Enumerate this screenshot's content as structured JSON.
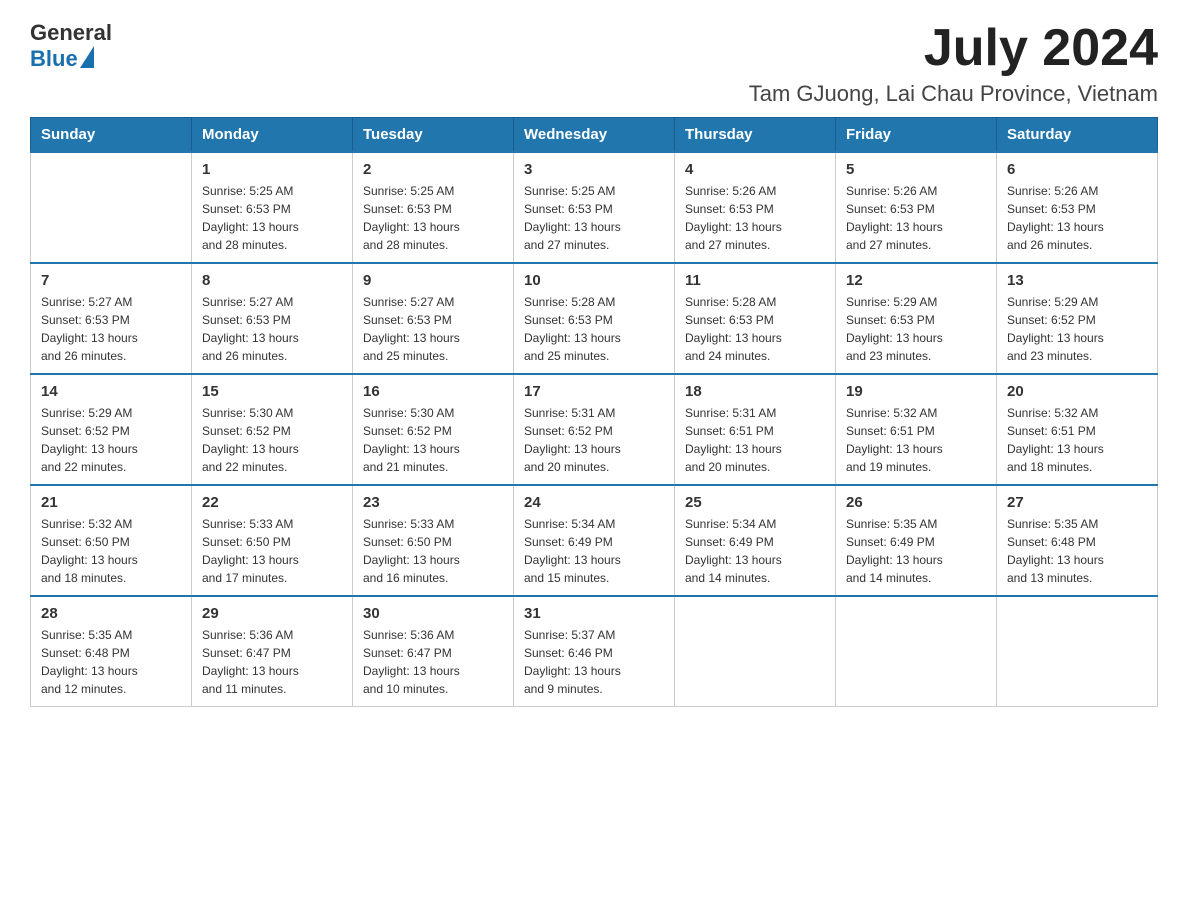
{
  "header": {
    "logo_general": "General",
    "logo_blue": "Blue",
    "month_year": "July 2024",
    "location": "Tam GJuong, Lai Chau Province, Vietnam"
  },
  "weekdays": [
    "Sunday",
    "Monday",
    "Tuesday",
    "Wednesday",
    "Thursday",
    "Friday",
    "Saturday"
  ],
  "weeks": [
    [
      {
        "day": "",
        "info": ""
      },
      {
        "day": "1",
        "info": "Sunrise: 5:25 AM\nSunset: 6:53 PM\nDaylight: 13 hours\nand 28 minutes."
      },
      {
        "day": "2",
        "info": "Sunrise: 5:25 AM\nSunset: 6:53 PM\nDaylight: 13 hours\nand 28 minutes."
      },
      {
        "day": "3",
        "info": "Sunrise: 5:25 AM\nSunset: 6:53 PM\nDaylight: 13 hours\nand 27 minutes."
      },
      {
        "day": "4",
        "info": "Sunrise: 5:26 AM\nSunset: 6:53 PM\nDaylight: 13 hours\nand 27 minutes."
      },
      {
        "day": "5",
        "info": "Sunrise: 5:26 AM\nSunset: 6:53 PM\nDaylight: 13 hours\nand 27 minutes."
      },
      {
        "day": "6",
        "info": "Sunrise: 5:26 AM\nSunset: 6:53 PM\nDaylight: 13 hours\nand 26 minutes."
      }
    ],
    [
      {
        "day": "7",
        "info": "Sunrise: 5:27 AM\nSunset: 6:53 PM\nDaylight: 13 hours\nand 26 minutes."
      },
      {
        "day": "8",
        "info": "Sunrise: 5:27 AM\nSunset: 6:53 PM\nDaylight: 13 hours\nand 26 minutes."
      },
      {
        "day": "9",
        "info": "Sunrise: 5:27 AM\nSunset: 6:53 PM\nDaylight: 13 hours\nand 25 minutes."
      },
      {
        "day": "10",
        "info": "Sunrise: 5:28 AM\nSunset: 6:53 PM\nDaylight: 13 hours\nand 25 minutes."
      },
      {
        "day": "11",
        "info": "Sunrise: 5:28 AM\nSunset: 6:53 PM\nDaylight: 13 hours\nand 24 minutes."
      },
      {
        "day": "12",
        "info": "Sunrise: 5:29 AM\nSunset: 6:53 PM\nDaylight: 13 hours\nand 23 minutes."
      },
      {
        "day": "13",
        "info": "Sunrise: 5:29 AM\nSunset: 6:52 PM\nDaylight: 13 hours\nand 23 minutes."
      }
    ],
    [
      {
        "day": "14",
        "info": "Sunrise: 5:29 AM\nSunset: 6:52 PM\nDaylight: 13 hours\nand 22 minutes."
      },
      {
        "day": "15",
        "info": "Sunrise: 5:30 AM\nSunset: 6:52 PM\nDaylight: 13 hours\nand 22 minutes."
      },
      {
        "day": "16",
        "info": "Sunrise: 5:30 AM\nSunset: 6:52 PM\nDaylight: 13 hours\nand 21 minutes."
      },
      {
        "day": "17",
        "info": "Sunrise: 5:31 AM\nSunset: 6:52 PM\nDaylight: 13 hours\nand 20 minutes."
      },
      {
        "day": "18",
        "info": "Sunrise: 5:31 AM\nSunset: 6:51 PM\nDaylight: 13 hours\nand 20 minutes."
      },
      {
        "day": "19",
        "info": "Sunrise: 5:32 AM\nSunset: 6:51 PM\nDaylight: 13 hours\nand 19 minutes."
      },
      {
        "day": "20",
        "info": "Sunrise: 5:32 AM\nSunset: 6:51 PM\nDaylight: 13 hours\nand 18 minutes."
      }
    ],
    [
      {
        "day": "21",
        "info": "Sunrise: 5:32 AM\nSunset: 6:50 PM\nDaylight: 13 hours\nand 18 minutes."
      },
      {
        "day": "22",
        "info": "Sunrise: 5:33 AM\nSunset: 6:50 PM\nDaylight: 13 hours\nand 17 minutes."
      },
      {
        "day": "23",
        "info": "Sunrise: 5:33 AM\nSunset: 6:50 PM\nDaylight: 13 hours\nand 16 minutes."
      },
      {
        "day": "24",
        "info": "Sunrise: 5:34 AM\nSunset: 6:49 PM\nDaylight: 13 hours\nand 15 minutes."
      },
      {
        "day": "25",
        "info": "Sunrise: 5:34 AM\nSunset: 6:49 PM\nDaylight: 13 hours\nand 14 minutes."
      },
      {
        "day": "26",
        "info": "Sunrise: 5:35 AM\nSunset: 6:49 PM\nDaylight: 13 hours\nand 14 minutes."
      },
      {
        "day": "27",
        "info": "Sunrise: 5:35 AM\nSunset: 6:48 PM\nDaylight: 13 hours\nand 13 minutes."
      }
    ],
    [
      {
        "day": "28",
        "info": "Sunrise: 5:35 AM\nSunset: 6:48 PM\nDaylight: 13 hours\nand 12 minutes."
      },
      {
        "day": "29",
        "info": "Sunrise: 5:36 AM\nSunset: 6:47 PM\nDaylight: 13 hours\nand 11 minutes."
      },
      {
        "day": "30",
        "info": "Sunrise: 5:36 AM\nSunset: 6:47 PM\nDaylight: 13 hours\nand 10 minutes."
      },
      {
        "day": "31",
        "info": "Sunrise: 5:37 AM\nSunset: 6:46 PM\nDaylight: 13 hours\nand 9 minutes."
      },
      {
        "day": "",
        "info": ""
      },
      {
        "day": "",
        "info": ""
      },
      {
        "day": "",
        "info": ""
      }
    ]
  ]
}
